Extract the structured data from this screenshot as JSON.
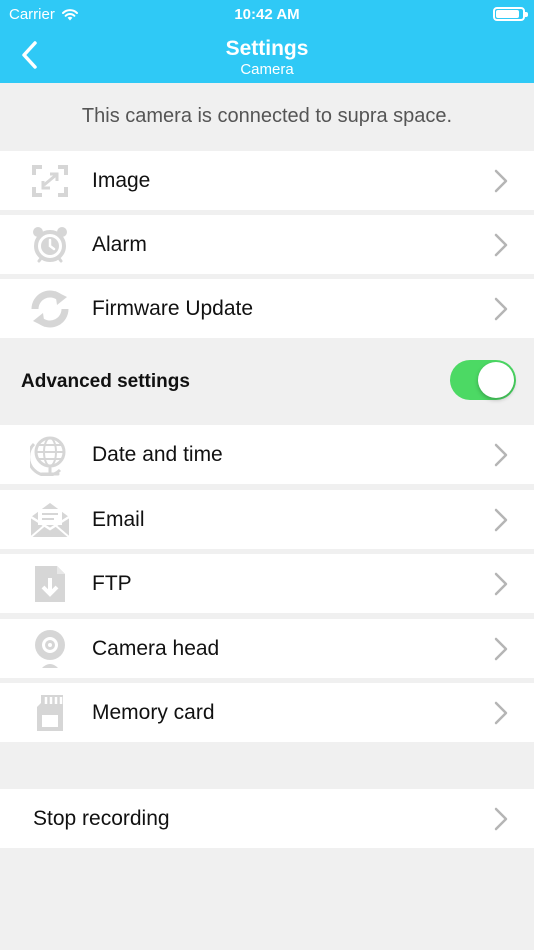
{
  "status_bar": {
    "carrier": "Carrier",
    "time": "10:42 AM",
    "battery_level": 0.9
  },
  "nav": {
    "back_icon": "chevron-left-icon",
    "title": "Settings",
    "subtitle": "Camera"
  },
  "banner": {
    "text": "This camera is connected to supra space."
  },
  "menu": {
    "image": {
      "label": "Image",
      "icon": "image-crop-icon"
    },
    "alarm": {
      "label": "Alarm",
      "icon": "alarm-clock-icon"
    },
    "firmware": {
      "label": "Firmware Update",
      "icon": "refresh-icon"
    }
  },
  "advanced": {
    "label": "Advanced settings",
    "enabled": true,
    "accent_color": "#4cd964"
  },
  "advanced_menu": {
    "date_time": {
      "label": "Date and time",
      "icon": "globe-icon"
    },
    "email": {
      "label": "Email",
      "icon": "envelope-icon"
    },
    "ftp": {
      "label": "FTP",
      "icon": "file-download-icon"
    },
    "camera_head": {
      "label": "Camera head",
      "icon": "webcam-icon"
    },
    "memory_card": {
      "label": "Memory card",
      "icon": "sd-card-icon"
    }
  },
  "stop_recording": {
    "label": "Stop recording"
  },
  "colors": {
    "header": "#2fc9f6",
    "background": "#f0f0f0",
    "icon_gray": "#d6d6d6",
    "chevron": "#b5b5b5"
  }
}
